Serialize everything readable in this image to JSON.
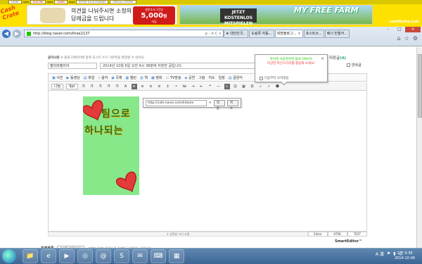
{
  "ad_toolbar": {
    "nav_items": [
      "HOME",
      "",
      "",
      "",
      "REFER YOUR FRIENDS",
      "SPECIAL OFFERS"
    ],
    "counter_values": [
      "0165186",
      "00089"
    ],
    "brand_logo_text": "Cash Crate",
    "ad1_line1": "의견을 나눠주시면 소정의",
    "ad1_line2": "답례금을 드립니다",
    "ad1_badge_top": "설문조사 1건당",
    "ad1_badge_amount": "5,000",
    "ad1_badge_unit": "원",
    "ad1_badge_bottom": "지급",
    "ad2_button": "JETZT KOSTENLOS MITSPIELEN",
    "ad2_title": "MY FREE FARM",
    "site_brand": "cashfiesta.com"
  },
  "browser": {
    "url": "http://blog.naver.com/khee2137",
    "address_tools": "ρ - ⊘ C ×",
    "tabs": [
      {
        "label": "★ 대한민국...",
        "active": false
      },
      {
        "label": "도림류 자동...",
        "active": false
      },
      {
        "label": "희망블로그...",
        "active": true
      },
      {
        "label": "포스트쓰...",
        "active": false
      },
      {
        "label": "베너 만들어...",
        "active": false
      }
    ],
    "window_controls": [
      "–",
      "□",
      "×"
    ]
  },
  "editor": {
    "breadcrumb_label": "글작사랑",
    "breadcrumb_text": "※ 블로그레이어에 맞춰 포스트 쓰기 기본폭을 환장할 수 있어요.",
    "temp_saved_label": "임시 저장글",
    "temp_saved_count": "(4)",
    "category": "캘리와캘리아",
    "title_placeholder": "2014년 10월 6일 오전 9시 38분에 저장한 글입니다.",
    "public_label": "전체공개",
    "public_check_label": "연회글",
    "toolbar1": [
      "사진",
      "동영상",
      "파일",
      "음악",
      "국제",
      "캘린",
      "책",
      "영화",
      "TV방송",
      "공연",
      "그림",
      "지도",
      "일정",
      "글양식"
    ],
    "font_family": "나눔",
    "font_size": "9pt",
    "toolbar2_buttons": [
      "가",
      "가",
      "가",
      "가",
      "가",
      "A"
    ],
    "popup_line1": "라이엔 사용자라면 블로그에서도",
    "popup_line2": "다양한 라인스티커를 활용해 보세요!",
    "popup_checkbox": "다음부터 보지않음",
    "link_url": "http://cafe.naver.com/kiteam",
    "link_ok": "적용",
    "link_cancel": "취소",
    "canvas_text1": "팀으로",
    "canvas_text2": "하나되는",
    "resize_label": "↕ 입력창 크기 조절",
    "modes": [
      "Editor",
      "HTML",
      "TEXT"
    ],
    "smarteditor_label": "SmartEditor™",
    "bottom_label": "주제분류",
    "bottom_select": "주제를 선택하세요",
    "bottom_hint": "선택한 주제는 블로그 중 주제별 글 목록에 노출됩니다."
  },
  "taskbar": {
    "apps": [
      "📁",
      "e",
      "▶",
      "◎",
      "@",
      "S",
      "✉",
      "⌨",
      "▦"
    ],
    "tray_lang": "A 漢",
    "clock_time": "오전 9:38",
    "clock_date": "2014-10-06"
  },
  "colors": {
    "adbar_bg": "#fde100",
    "naver_green": "#1ec800",
    "canvas_bg": "#87e88a",
    "heart_red": "#e43a3a"
  }
}
